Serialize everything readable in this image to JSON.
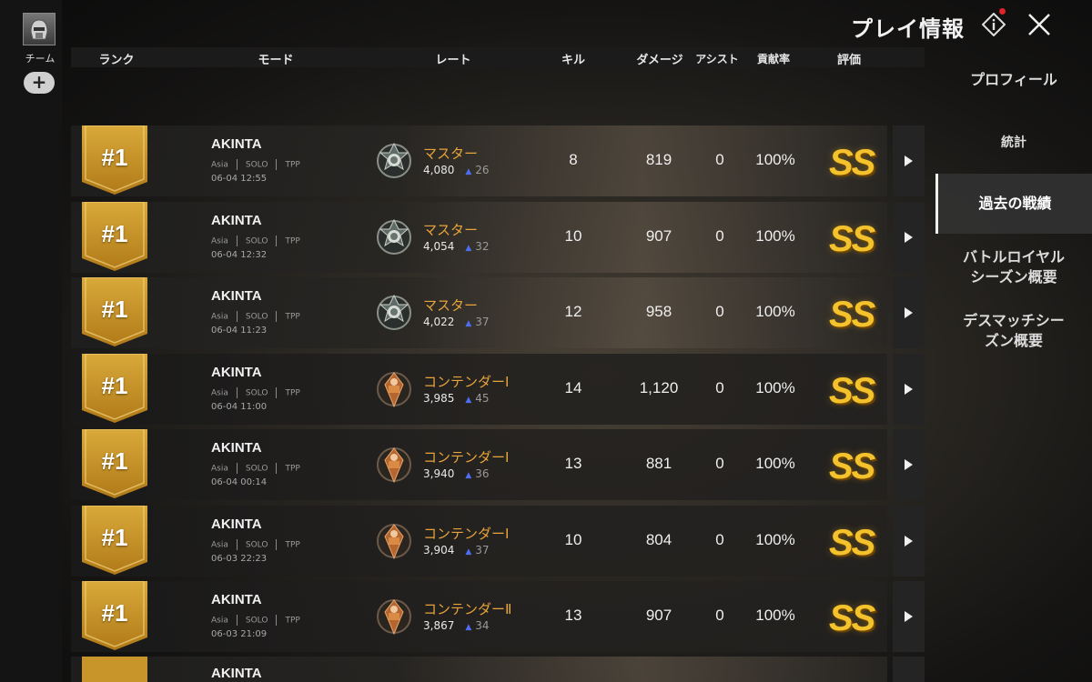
{
  "team": {
    "label": "チーム",
    "add_label": "+"
  },
  "header": {
    "title": "プレイ情報"
  },
  "columns": {
    "rank": "ランク",
    "mode": "モード",
    "rate": "レート",
    "kills": "キル",
    "damage": "ダメージ",
    "assist": "アシスト",
    "contribution": "貢献率",
    "grade": "評価"
  },
  "rows": [
    {
      "rank": "#1",
      "name": "AKINTA",
      "region": "Asia",
      "mode": "SOLO",
      "view": "TPP",
      "date": "06-04 12:55",
      "tier": "マスター",
      "tier_type": "master",
      "rate": "4,080",
      "rate_delta": "26",
      "kills": "8",
      "damage": "819",
      "assist": "0",
      "contribution": "100%",
      "grade": "SS"
    },
    {
      "rank": "#1",
      "name": "AKINTA",
      "region": "Asia",
      "mode": "SOLO",
      "view": "TPP",
      "date": "06-04 12:32",
      "tier": "マスター",
      "tier_type": "master",
      "rate": "4,054",
      "rate_delta": "32",
      "kills": "10",
      "damage": "907",
      "assist": "0",
      "contribution": "100%",
      "grade": "SS"
    },
    {
      "rank": "#1",
      "name": "AKINTA",
      "region": "Asia",
      "mode": "SOLO",
      "view": "TPP",
      "date": "06-04 11:23",
      "tier": "マスター",
      "tier_type": "master",
      "rate": "4,022",
      "rate_delta": "37",
      "kills": "12",
      "damage": "958",
      "assist": "0",
      "contribution": "100%",
      "grade": "SS"
    },
    {
      "rank": "#1",
      "name": "AKINTA",
      "region": "Asia",
      "mode": "SOLO",
      "view": "TPP",
      "date": "06-04 11:00",
      "tier": "コンテンダーⅠ",
      "tier_type": "contender",
      "rate": "3,985",
      "rate_delta": "45",
      "kills": "14",
      "damage": "1,120",
      "assist": "0",
      "contribution": "100%",
      "grade": "SS"
    },
    {
      "rank": "#1",
      "name": "AKINTA",
      "region": "Asia",
      "mode": "SOLO",
      "view": "TPP",
      "date": "06-04 00:14",
      "tier": "コンテンダーⅠ",
      "tier_type": "contender",
      "rate": "3,940",
      "rate_delta": "36",
      "kills": "13",
      "damage": "881",
      "assist": "0",
      "contribution": "100%",
      "grade": "SS"
    },
    {
      "rank": "#1",
      "name": "AKINTA",
      "region": "Asia",
      "mode": "SOLO",
      "view": "TPP",
      "date": "06-03 22:23",
      "tier": "コンテンダーⅠ",
      "tier_type": "contender",
      "rate": "3,904",
      "rate_delta": "37",
      "kills": "10",
      "damage": "804",
      "assist": "0",
      "contribution": "100%",
      "grade": "SS"
    },
    {
      "rank": "#1",
      "name": "AKINTA",
      "region": "Asia",
      "mode": "SOLO",
      "view": "TPP",
      "date": "06-03 21:09",
      "tier": "コンテンダーⅡ",
      "tier_type": "contender",
      "rate": "3,867",
      "rate_delta": "34",
      "kills": "13",
      "damage": "907",
      "assist": "0",
      "contribution": "100%",
      "grade": "SS"
    }
  ],
  "partial_row": {
    "name": "AKINTA"
  },
  "nav": {
    "profile": "プロフィール",
    "stats": "統計",
    "history": "過去の戦績",
    "br_line1": "バトルロイヤル",
    "br_line2": "シーズン概要",
    "dm_line1": "デスマッチシー",
    "dm_line2": "ズン概要"
  },
  "colors": {
    "accent_gold": "#f3c22d",
    "tier_text": "#e7a43a",
    "rate_up": "#4c6df0",
    "notification": "#e0222a"
  }
}
